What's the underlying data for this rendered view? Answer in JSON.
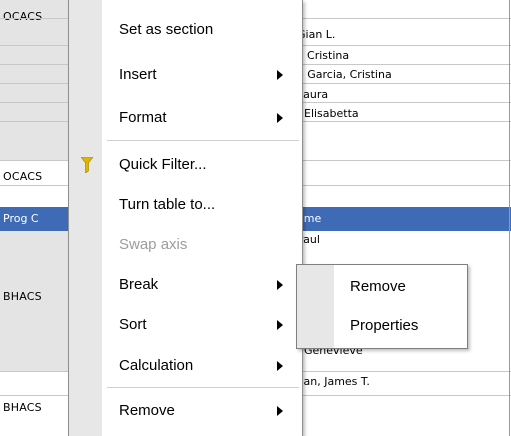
{
  "report": {
    "codes": [
      "OCACS",
      "OCACS",
      "BHACS",
      "BHACS"
    ],
    "header_left": "Prog C",
    "header_right": "ame",
    "names_top": [
      "Gian L.",
      "i, Cristina",
      "o Garcia, Cristina",
      "Laura",
      ", Elisabetta"
    ],
    "names_bottom": [
      "Paul",
      ", Genevieve",
      "van, James T."
    ]
  },
  "context_menu": {
    "items": [
      {
        "label": "Set as section"
      },
      {
        "label": "Insert"
      },
      {
        "label": "Format"
      },
      {
        "label": "Quick Filter..."
      },
      {
        "label": "Turn table to..."
      },
      {
        "label": "Swap axis"
      },
      {
        "label": "Break"
      },
      {
        "label": "Sort"
      },
      {
        "label": "Calculation"
      },
      {
        "label": "Remove"
      }
    ],
    "icons": {
      "quick_filter": "funnel-icon"
    },
    "colors": {
      "funnel": "#e0b400",
      "disabled_text": "#9c9c9c"
    }
  },
  "submenu": {
    "items": [
      {
        "label": "Remove"
      },
      {
        "label": "Properties"
      }
    ]
  },
  "colors": {
    "header_band": "#3f6bb6",
    "gutter": "#e7e7e7"
  }
}
